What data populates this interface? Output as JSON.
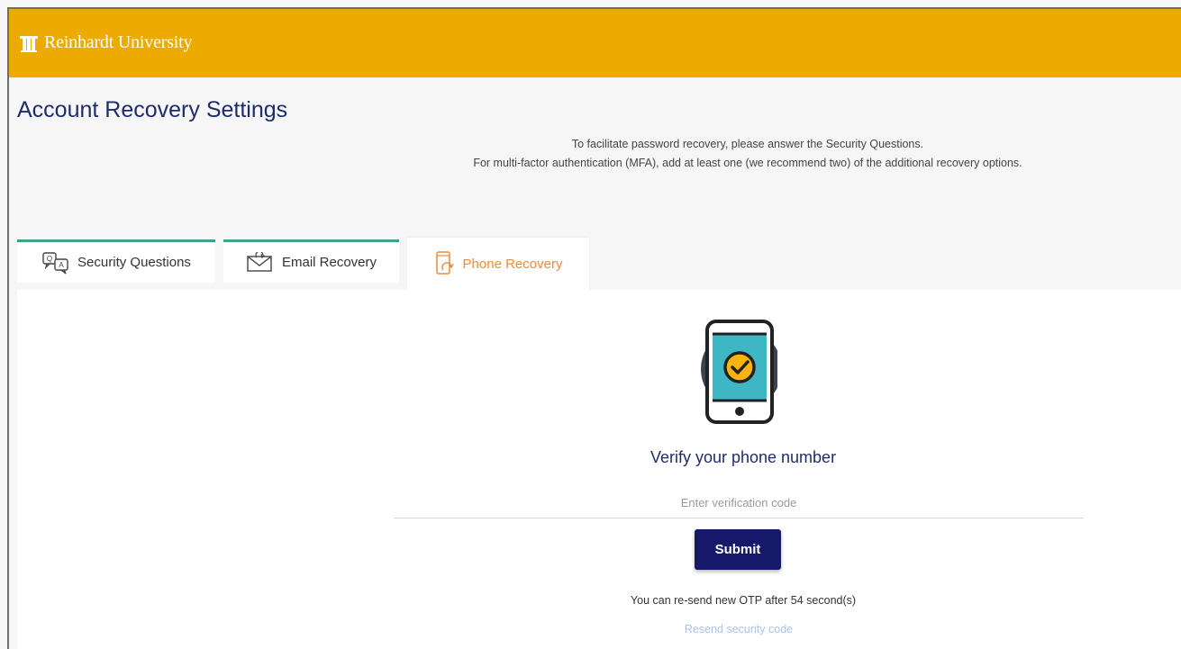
{
  "header": {
    "brand": "Reinhardt University",
    "logo_icon": "university-building-icon",
    "color": "#edaa00"
  },
  "page": {
    "title": "Account Recovery Settings",
    "intro_line_1": "To facilitate password recovery, please answer the Security Questions.",
    "intro_line_2": "For multi-factor authentication (MFA), add at least one (we recommend two) of the additional recovery options."
  },
  "tabs": [
    {
      "label": "Security Questions",
      "icon": "qa-chat-icon",
      "active": false
    },
    {
      "label": "Email Recovery",
      "icon": "envelope-icon",
      "active": false
    },
    {
      "label": "Phone Recovery",
      "icon": "phone-refresh-icon",
      "active": true
    }
  ],
  "verify": {
    "illustration": "phone-check-icon",
    "title": "Verify your phone number",
    "code_placeholder": "Enter verification code",
    "code_value": "",
    "submit_label": "Submit",
    "otp_message": "You can re-send new OTP after 54 second(s)",
    "resend_label": "Resend security code"
  },
  "colors": {
    "accent_navy": "#1f2c6b",
    "button_navy": "#16186a",
    "tab_border_green": "#3aa389",
    "active_tab_orange": "#ef8a3a",
    "link_light_blue": "#a8c4e8"
  }
}
